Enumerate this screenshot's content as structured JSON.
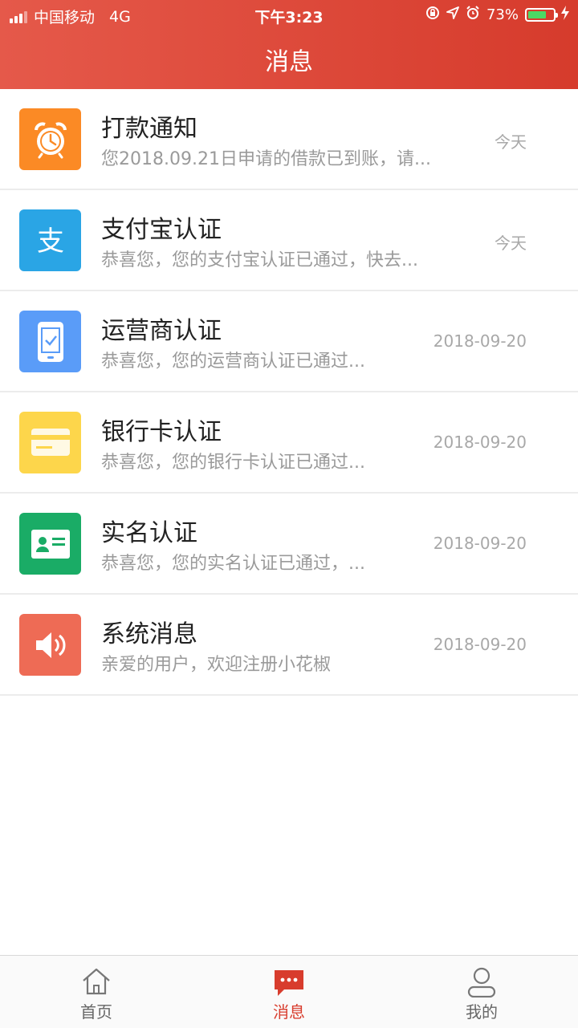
{
  "status_bar": {
    "carrier": "中国移动",
    "network": "4G",
    "time": "下午3:23",
    "battery": "73%",
    "battery_level": 0.73
  },
  "header": {
    "title": "消息"
  },
  "colors": {
    "accent": "#d83c2d",
    "header_gradient": [
      "#e5594a",
      "#d63b2c"
    ]
  },
  "messages": [
    {
      "icon": "alarm-clock-icon",
      "color": "#fb8a25",
      "title": "打款通知",
      "preview": "您2018.09.21日申请的借款已到账，请...",
      "date": "今天"
    },
    {
      "icon": "alipay-icon",
      "color": "#2aa5e5",
      "title": "支付宝认证",
      "preview": "恭喜您，您的支付宝认证已通过，快去...",
      "date": "今天"
    },
    {
      "icon": "mobile-phone-icon",
      "color": "#5a9cf8",
      "title": "运营商认证",
      "preview": "恭喜您，您的运营商认证已通过...",
      "date": "2018-09-20"
    },
    {
      "icon": "bank-card-icon",
      "color": "#fdd64b",
      "title": "银行卡认证",
      "preview": "恭喜您，您的银行卡认证已通过...",
      "date": "2018-09-20"
    },
    {
      "icon": "id-card-icon",
      "color": "#1aac66",
      "title": "实名认证",
      "preview": "恭喜您，您的实名认证已通过，...",
      "date": "2018-09-20"
    },
    {
      "icon": "speaker-icon",
      "color": "#ee6b55",
      "title": "系统消息",
      "preview": "亲爱的用户，欢迎注册小花椒",
      "date": "2018-09-20"
    }
  ],
  "tabbar": {
    "items": [
      {
        "label": "首页",
        "icon": "home-icon",
        "active": false
      },
      {
        "label": "消息",
        "icon": "message-icon",
        "active": true
      },
      {
        "label": "我的",
        "icon": "user-icon",
        "active": false
      }
    ]
  }
}
